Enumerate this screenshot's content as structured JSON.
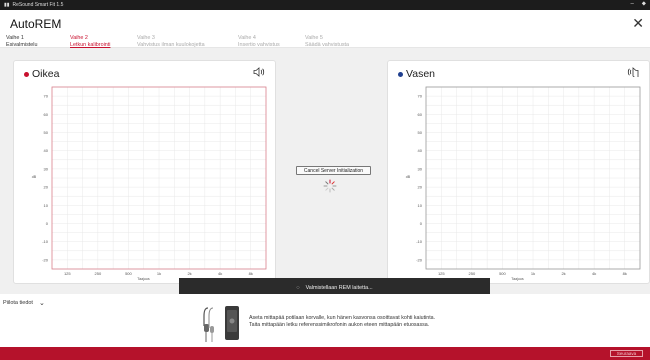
{
  "titlebar": {
    "app_title": "ReSound Smart Fit 1.5"
  },
  "header": {
    "title": "AutoREM"
  },
  "steps": [
    {
      "number": "Vaihe 1",
      "name": "Esivalmistelu",
      "state": "done"
    },
    {
      "number": "Vaihe 2",
      "name": "Letkun kalibrointi",
      "state": "active"
    },
    {
      "number": "Vaihe 3",
      "name": "Vahvistus ilman kuulokojetta",
      "state": "pending"
    },
    {
      "number": "Vaihe 4",
      "name": "Insertio vahvistus",
      "state": "pending"
    },
    {
      "number": "Vaihe 5",
      "name": "Säädä vahvistusta",
      "state": "pending"
    }
  ],
  "left_panel": {
    "title": "Oikea",
    "dot_color": "#c8102e",
    "frame_color": "#d9808c",
    "speaker_icon": "speaker-icon"
  },
  "right_panel": {
    "title": "Vasen",
    "dot_color": "#1f3f8f",
    "frame_color": "#999999",
    "speaker_icon": "speaker-icon"
  },
  "chart_axes": {
    "y_ticks": [
      "70",
      "60",
      "50",
      "40",
      "30",
      "20",
      "10",
      "0",
      "-10",
      "-20"
    ],
    "x_ticks": [
      "125",
      "250",
      "500",
      "1k",
      "2k",
      "4k",
      "8k"
    ],
    "y_label": "dB",
    "x_label": "Taajuus"
  },
  "chart_data": [
    {
      "type": "line",
      "title": "Oikea",
      "x": [],
      "series": [],
      "xticks": [
        "125",
        "250",
        "500",
        "1k",
        "2k",
        "4k",
        "8k"
      ],
      "yticks": [
        "70",
        "60",
        "50",
        "40",
        "30",
        "20",
        "10",
        "0",
        "-10",
        "-20"
      ],
      "xlabel": "Taajuus",
      "ylabel": "dB",
      "ylim": [
        -25,
        75
      ],
      "grid": true
    },
    {
      "type": "line",
      "title": "Vasen",
      "x": [],
      "series": [],
      "xticks": [
        "125",
        "250",
        "500",
        "1k",
        "2k",
        "4k",
        "8k"
      ],
      "yticks": [
        "70",
        "60",
        "50",
        "40",
        "30",
        "20",
        "10",
        "0",
        "-10",
        "-20"
      ],
      "xlabel": "Taajuus",
      "ylabel": "dB",
      "ylim": [
        -25,
        75
      ],
      "grid": true
    }
  ],
  "center": {
    "cancel_label": "Cancel Server Initialization"
  },
  "toast": {
    "text": "Valmistellaan REM laitetta..."
  },
  "bottom": {
    "hide_info_label": "Piilota tiedot",
    "instruction_line1": "Aseta mittapää potilaan korvalle, kun hänen kasvonsa osoittavat kohti kaiutinta.",
    "instruction_line2": "Taita mittapään letku referenssimikrofonin aukon eteen mittapään etuosassa."
  },
  "footer": {
    "next_label": "Seuraava",
    "accent": "#b5122b"
  }
}
